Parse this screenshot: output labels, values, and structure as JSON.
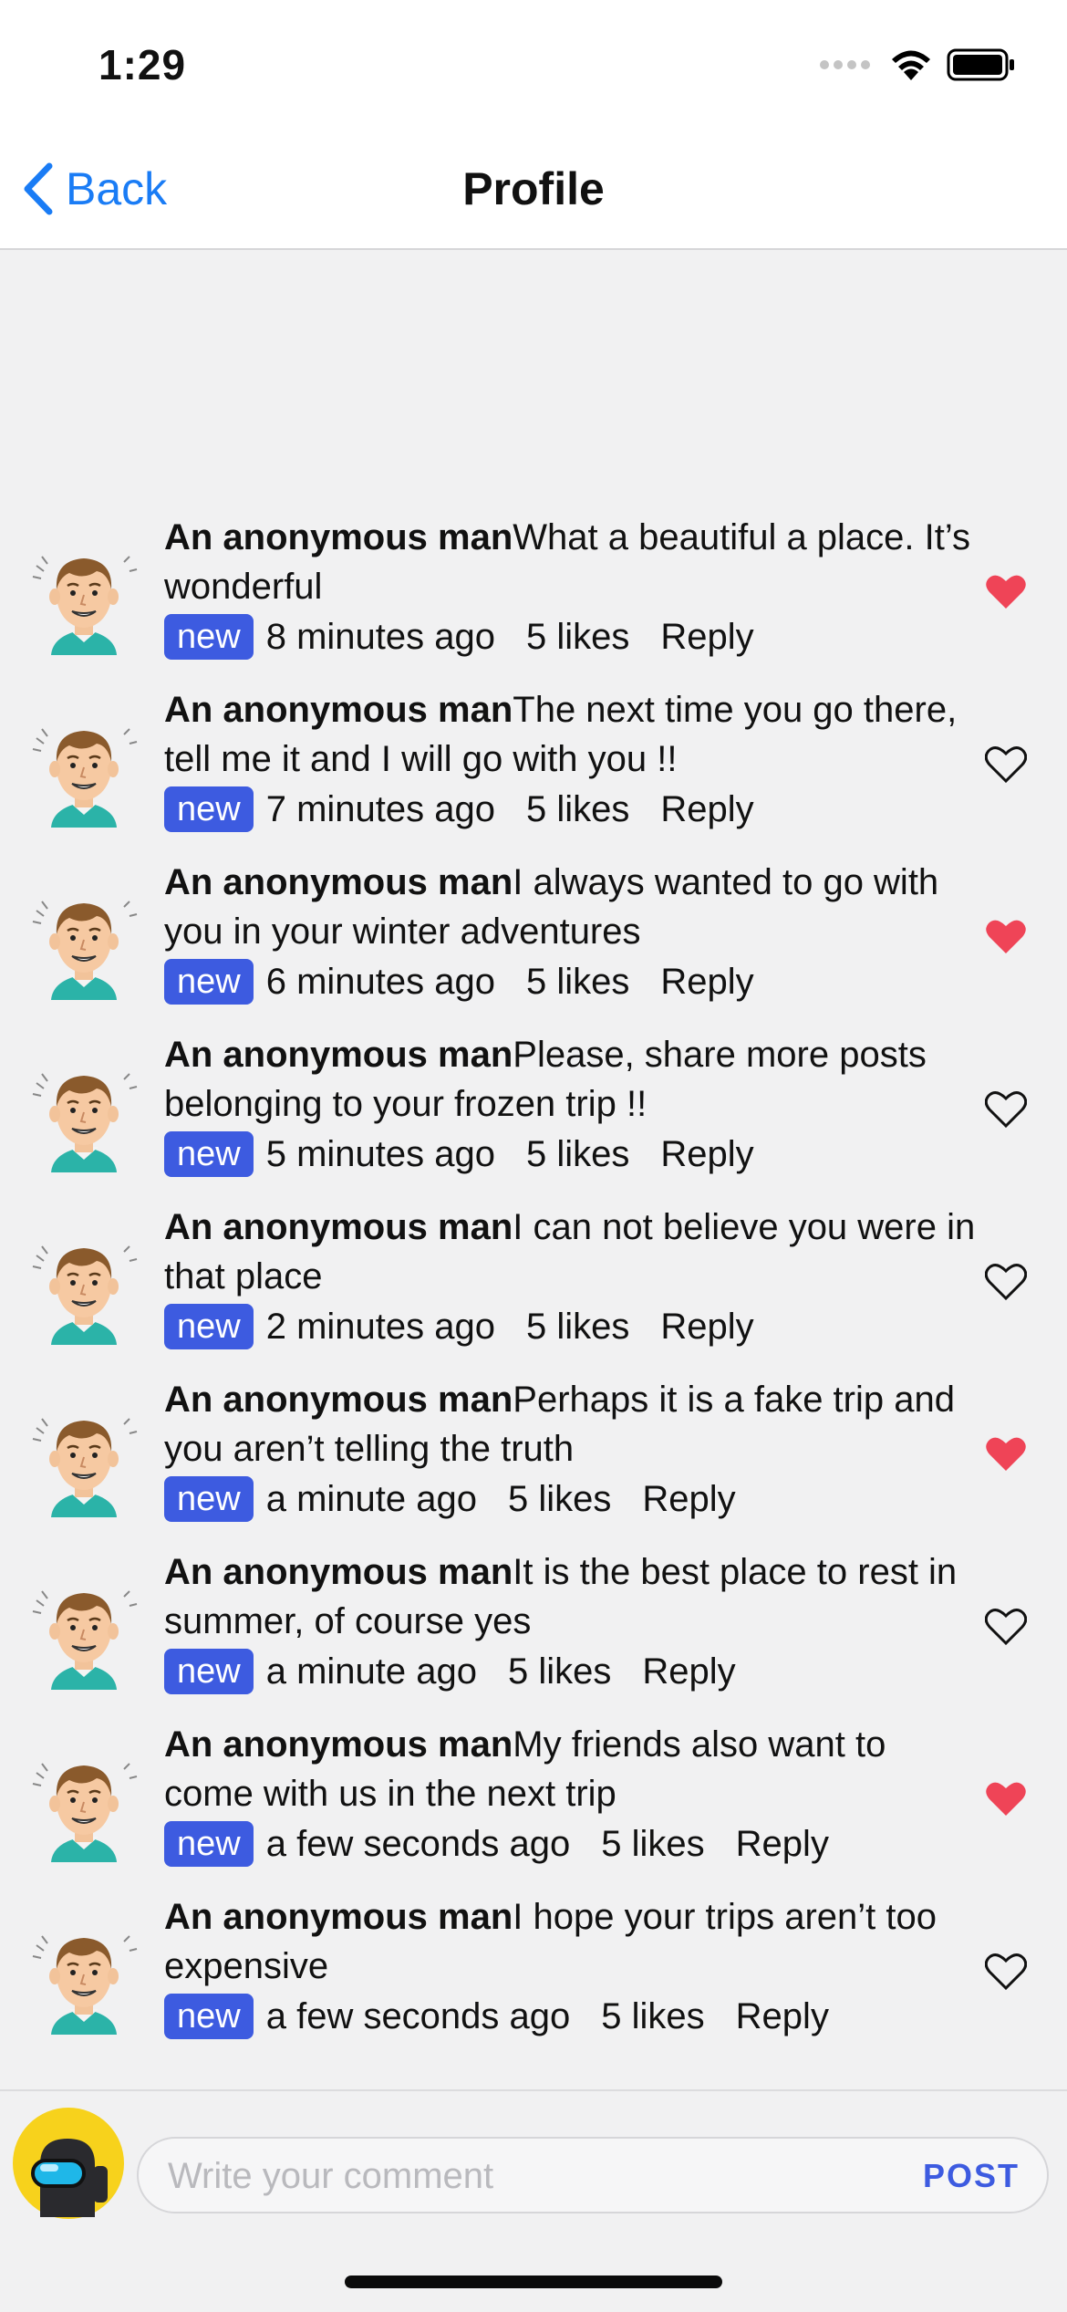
{
  "status": {
    "time": "1:29"
  },
  "nav": {
    "back_label": "Back",
    "title": "Profile"
  },
  "colors": {
    "accent": "#1a7cf5",
    "badge": "#3d5be0",
    "liked": "#ef4457",
    "background": "#f1f1f2"
  },
  "comments": [
    {
      "author": "An anonymous man",
      "text": "What a beautiful a place. It’s wonderful",
      "badge": "new",
      "time": "8 minutes ago",
      "likes": "5 likes",
      "reply": "Reply",
      "liked": true
    },
    {
      "author": "An anonymous man",
      "text": "The next time you go there, tell me it and I will go with you !!",
      "badge": "new",
      "time": "7 minutes ago",
      "likes": "5 likes",
      "reply": "Reply",
      "liked": false
    },
    {
      "author": "An anonymous man",
      "text": "I always wanted to go with you in your winter adventures",
      "badge": "new",
      "time": "6 minutes ago",
      "likes": "5 likes",
      "reply": "Reply",
      "liked": true
    },
    {
      "author": "An anonymous man",
      "text": "Please, share more posts belonging to your frozen trip !!",
      "badge": "new",
      "time": "5 minutes ago",
      "likes": "5 likes",
      "reply": "Reply",
      "liked": false
    },
    {
      "author": "An anonymous man",
      "text": "I can not believe you were in that place",
      "badge": "new",
      "time": "2 minutes ago",
      "likes": "5 likes",
      "reply": "Reply",
      "liked": false
    },
    {
      "author": "An anonymous man",
      "text": "Perhaps it is a fake trip and you aren’t telling the truth",
      "badge": "new",
      "time": "a minute ago",
      "likes": "5 likes",
      "reply": "Reply",
      "liked": true
    },
    {
      "author": "An anonymous man",
      "text": "It is the best place to rest in summer, of course yes",
      "badge": "new",
      "time": "a minute ago",
      "likes": "5 likes",
      "reply": "Reply",
      "liked": false
    },
    {
      "author": "An anonymous man",
      "text": "My friends also want to come with us in the next trip",
      "badge": "new",
      "time": "a few seconds ago",
      "likes": "5 likes",
      "reply": "Reply",
      "liked": true
    },
    {
      "author": "An anonymous man",
      "text": "I hope your trips aren’t too expensive",
      "badge": "new",
      "time": "a few seconds ago",
      "likes": "5 likes",
      "reply": "Reply",
      "liked": false
    }
  ],
  "composer": {
    "placeholder": "Write your comment",
    "value": "",
    "post_label": "POST"
  }
}
